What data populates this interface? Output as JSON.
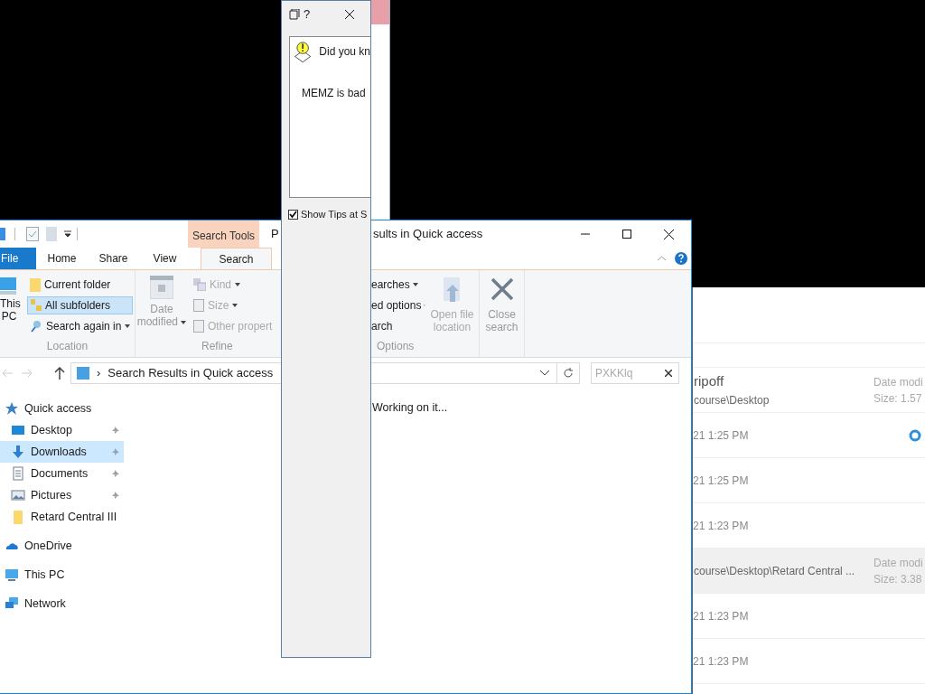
{
  "tips_dialog": {
    "title": "?",
    "heading": "Did you kn",
    "tip": "MEMZ is bad",
    "show_tips": {
      "label": "Show Tips at S",
      "checked": true
    }
  },
  "explorer": {
    "title_left": "P",
    "title_right": "sults in Quick access",
    "context_tab": "Search Tools",
    "tabs": [
      {
        "label": "File",
        "kind": "file",
        "selected": false
      },
      {
        "label": "Home",
        "kind": "tab",
        "selected": false
      },
      {
        "label": "Share",
        "kind": "tab",
        "selected": false
      },
      {
        "label": "View",
        "kind": "tab",
        "selected": false
      },
      {
        "label": "Search",
        "kind": "tab",
        "selected": true
      }
    ],
    "location": {
      "this_pc": "This PC",
      "current_folder": {
        "label": "Current folder",
        "selected": false
      },
      "all_subfolders": {
        "label": "All subfolders",
        "selected": true
      },
      "search_again": "Search again in",
      "group": "Location"
    },
    "refine": {
      "date_modified": "Date modified",
      "kind": "Kind",
      "size": "Size",
      "other": "Other propert",
      "group": "Refine"
    },
    "options": {
      "recent": "earches",
      "advanced": "ed options",
      "save": "arch",
      "group": "Options",
      "open_location": {
        "label": "Open file location",
        "disabled": true
      },
      "close_search": {
        "label": "Close search",
        "disabled": false
      }
    },
    "address_separator": "›",
    "address": "Search Results in Quick access",
    "search": {
      "placeholder": "PXKKlq"
    },
    "nav": [
      {
        "label": "Quick access",
        "kind": "star",
        "selected": false,
        "children": [
          {
            "label": "Desktop",
            "kind": "desktop",
            "pinned": true,
            "selected": false
          },
          {
            "label": "Downloads",
            "kind": "download",
            "pinned": true,
            "selected": true
          },
          {
            "label": "Documents",
            "kind": "document",
            "pinned": true,
            "selected": false
          },
          {
            "label": "Pictures",
            "kind": "pictures",
            "pinned": true,
            "selected": false
          },
          {
            "label": "Retard Central III",
            "kind": "folder",
            "pinned": false,
            "selected": false
          }
        ]
      },
      {
        "label": "OneDrive",
        "kind": "cloud",
        "selected": false
      },
      {
        "label": "This PC",
        "kind": "pc",
        "selected": false
      },
      {
        "label": "Network",
        "kind": "network",
        "selected": false
      }
    ],
    "status": "Working on it..."
  },
  "results": [
    {
      "kind": "detail",
      "name": "ripoff",
      "path": "course\\Desktop",
      "date_label": "Date modi",
      "size": "Size: 1.57",
      "selected": false
    },
    {
      "kind": "date",
      "date": "21 1:25 PM",
      "syncing": true
    },
    {
      "kind": "date",
      "date": "21 1:25 PM",
      "syncing": false
    },
    {
      "kind": "date",
      "date": "21 1:23 PM",
      "syncing": false
    },
    {
      "kind": "detail",
      "path": "course\\Desktop\\Retard Central ...",
      "date_label": "Date modi",
      "size": "Size: 3.38",
      "selected": true
    },
    {
      "kind": "date",
      "date": "21 1:23 PM",
      "syncing": false
    },
    {
      "kind": "date",
      "date": "21 1:23 PM",
      "syncing": false
    }
  ]
}
